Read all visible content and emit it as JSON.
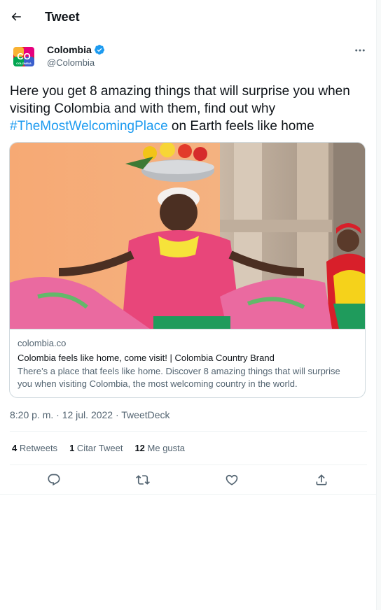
{
  "header": {
    "title": "Tweet",
    "back_icon": "arrow-left-icon"
  },
  "author": {
    "name": "Colombia",
    "handle": "@Colombia",
    "avatar_text": "CO",
    "avatar_subtext": "COLOMBIA",
    "verified_icon": "verified-badge-icon",
    "verified_color": "#1d9bf0"
  },
  "more_icon": "more-dots-icon",
  "tweet": {
    "text_before": "Here you get 8 amazing things that will surprise you when visiting Colombia and with them, find out why ",
    "hashtag": "#TheMostWelcomingPlace",
    "text_after": " on Earth feels like home"
  },
  "card": {
    "image_icon": "colombian-palenquera-photo",
    "domain": "colombia.co",
    "title": "Colombia feels like home, come visit! | Colombia Country Brand",
    "description": "There’s a place that feels like home. Discover 8 amazing things that will surprise you when visiting Colombia, the most welcoming country in the world."
  },
  "timestamp": "8:20 p. m. · 12 jul. 2022 · TweetDeck",
  "stats": {
    "retweets_count": "4",
    "retweets_label": "Retweets",
    "quotes_count": "1",
    "quotes_label": "Citar Tweet",
    "likes_count": "12",
    "likes_label": "Me gusta"
  },
  "actions": [
    "reply-icon",
    "retweet-icon",
    "like-icon",
    "share-icon"
  ],
  "colors": {
    "accent": "#1d9bf0",
    "text": "#0f1419",
    "secondary": "#536471",
    "border": "#cfd9de"
  }
}
